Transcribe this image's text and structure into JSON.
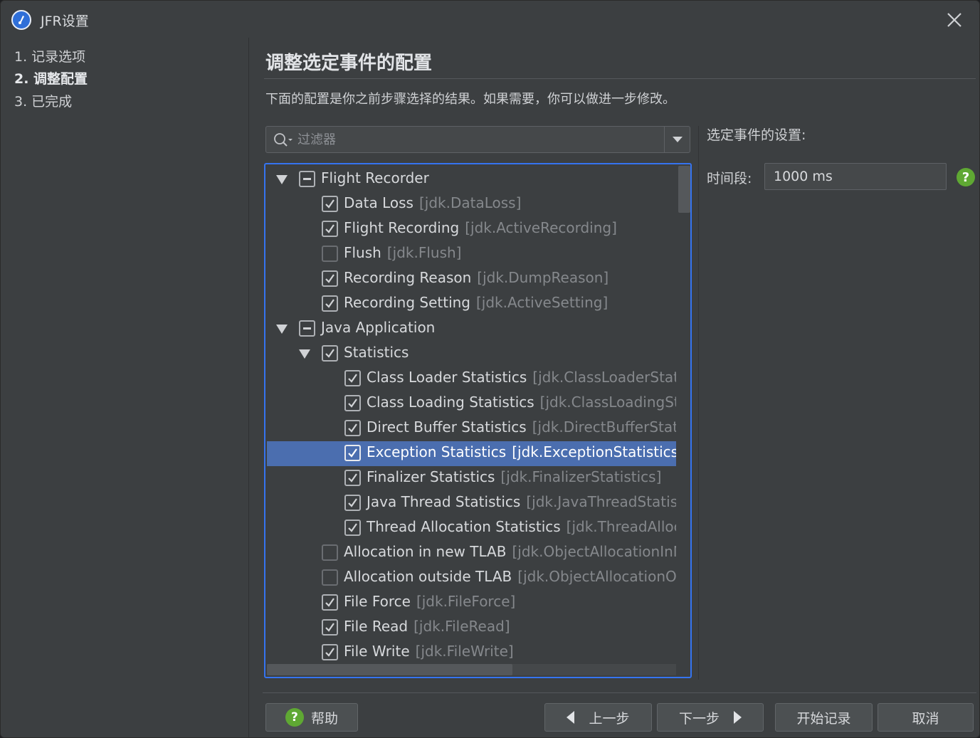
{
  "window": {
    "title": "JFR设置"
  },
  "sidebar": {
    "steps": [
      {
        "label": "1. 记录选项"
      },
      {
        "label": "2. 调整配置"
      },
      {
        "label": "3. 已完成"
      }
    ],
    "active_step": 2
  },
  "main": {
    "title": "调整选定事件的配置",
    "description": "下面的配置是你之前步骤选择的结果。如果需要，你可以做进一步修改。",
    "filter": {
      "placeholder": "过滤器",
      "value": ""
    },
    "tree": [
      {
        "label": "Flight Recorder",
        "id": "",
        "state": "indeterminate",
        "expanded": true
      },
      {
        "label": "Data Loss",
        "id": "[jdk.DataLoss]",
        "state": "checked"
      },
      {
        "label": "Flight Recording",
        "id": "[jdk.ActiveRecording]",
        "state": "checked"
      },
      {
        "label": "Flush",
        "id": "[jdk.Flush]",
        "state": "unchecked"
      },
      {
        "label": "Recording Reason",
        "id": "[jdk.DumpReason]",
        "state": "checked"
      },
      {
        "label": "Recording Setting",
        "id": "[jdk.ActiveSetting]",
        "state": "checked"
      },
      {
        "label": "Java Application",
        "id": "",
        "state": "indeterminate",
        "expanded": true
      },
      {
        "label": "Statistics",
        "id": "",
        "state": "checked",
        "expanded": true
      },
      {
        "label": "Class Loader Statistics",
        "id": "[jdk.ClassLoaderStatistics",
        "state": "checked"
      },
      {
        "label": "Class Loading Statistics",
        "id": "[jdk.ClassLoadingStatist",
        "state": "checked"
      },
      {
        "label": "Direct Buffer Statistics",
        "id": "[jdk.DirectBufferStatistics",
        "state": "checked"
      },
      {
        "label": "Exception Statistics",
        "id": "[jdk.ExceptionStatistics]",
        "state": "checked",
        "selected": true
      },
      {
        "label": "Finalizer Statistics",
        "id": "[jdk.FinalizerStatistics]",
        "state": "checked"
      },
      {
        "label": "Java Thread Statistics",
        "id": "[jdk.JavaThreadStatistics]",
        "state": "checked"
      },
      {
        "label": "Thread Allocation Statistics",
        "id": "[jdk.ThreadAllocatic",
        "state": "checked"
      },
      {
        "label": "Allocation in new TLAB",
        "id": "[jdk.ObjectAllocationInNew",
        "state": "unchecked"
      },
      {
        "label": "Allocation outside TLAB",
        "id": "[jdk.ObjectAllocationOutsi",
        "state": "unchecked"
      },
      {
        "label": "File Force",
        "id": "[jdk.FileForce]",
        "state": "checked"
      },
      {
        "label": "File Read",
        "id": "[jdk.FileRead]",
        "state": "checked"
      },
      {
        "label": "File Write",
        "id": "[jdk.FileWrite]",
        "state": "checked"
      }
    ],
    "settings": {
      "title": "选定事件的设置:",
      "period_label": "时间段:",
      "period_value": "1000 ms"
    }
  },
  "buttons": {
    "help": "帮助",
    "prev": "上一步",
    "next": "下一步",
    "start": "开始记录",
    "cancel": "取消"
  },
  "colors": {
    "accent": "#3574f0",
    "selection": "#4b6eaf",
    "help_green": "#5fa833",
    "background": "#3c3f41"
  }
}
